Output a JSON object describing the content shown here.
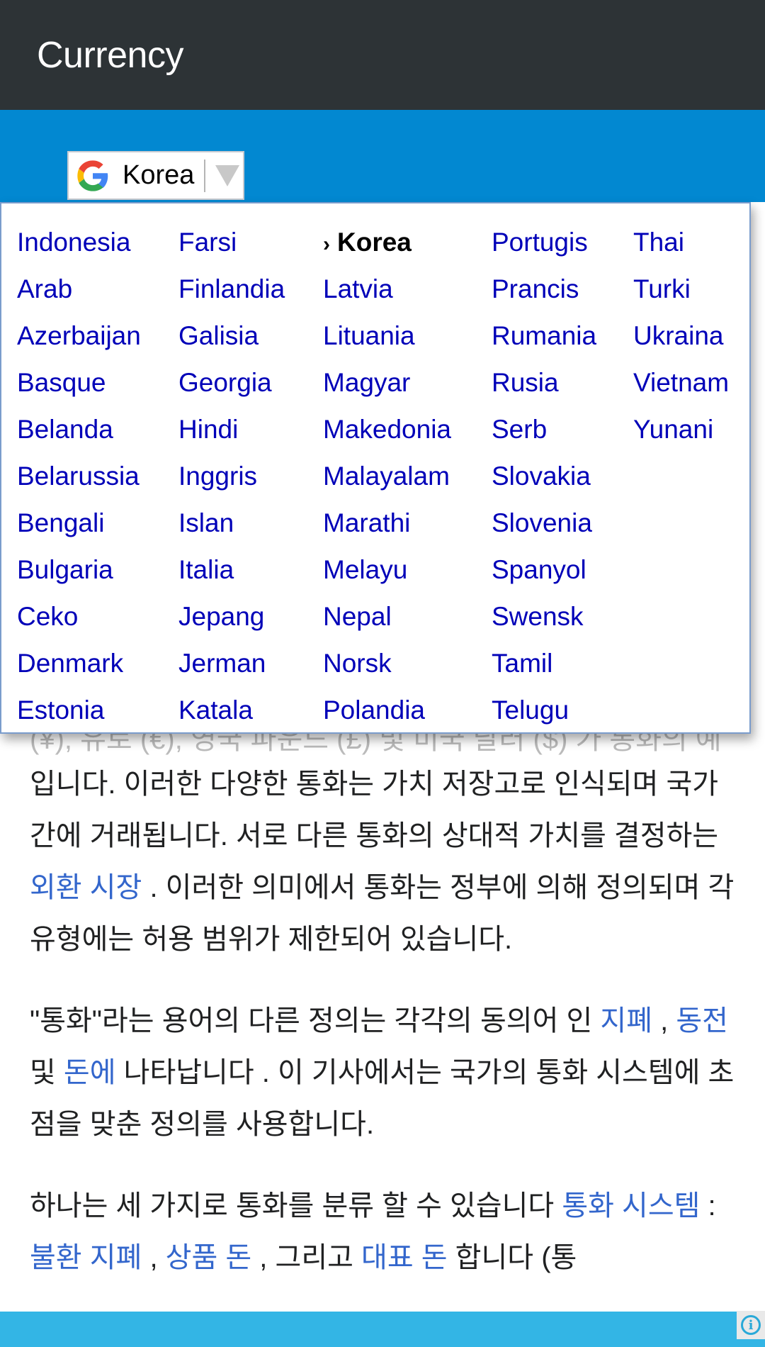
{
  "header": {
    "title": "Currency"
  },
  "translate_widget": {
    "icon": "google-g-icon",
    "selected_language": "Korea",
    "dropdown_icon": "triangle-down-icon"
  },
  "language_menu": {
    "selected": "Korea",
    "selected_marker": "›",
    "columns": [
      [
        "Indonesia",
        "Arab",
        "Azerbaijan",
        "Basque",
        "Belanda",
        "Belarussia",
        "Bengali",
        "Bulgaria",
        "Ceko",
        "Denmark",
        "Estonia"
      ],
      [
        "Farsi",
        "Finlandia",
        "Galisia",
        "Georgia",
        "Hindi",
        "Inggris",
        "Islan",
        "Italia",
        "Jepang",
        "Jerman",
        "Katala"
      ],
      [
        "Korea",
        "Latvia",
        "Lituania",
        "Magyar",
        "Makedonia",
        "Malayalam",
        "Marathi",
        "Melayu",
        "Nepal",
        "Norsk",
        "Polandia"
      ],
      [
        "Portugis",
        "Prancis",
        "Rumania",
        "Rusia",
        "Serb",
        "Slovakia",
        "Slovenia",
        "Spanyol",
        "Swensk",
        "Tamil",
        "Telugu"
      ],
      [
        "Thai",
        "Turki",
        "Ukraina",
        "Vietnam",
        "Yunani"
      ]
    ]
  },
  "article": {
    "ghost_line": "(¥), 유로 (€), 영국 파운드 (£) 및 미국 달러 ($) 가 통화의 예",
    "paragraphs": [
      {
        "segments": [
          {
            "text": "입니다. 이러한 다양한 통화는 가치 저장고로 인식되며 국가간에 거래됩니다. 서로 다른 통화의 상대적 가치를 결정하는 ",
            "link": false
          },
          {
            "text": "외환 시장",
            "link": true
          },
          {
            "text": " .  이러한 의미에서 통화는 정부에 의해 정의되며 각 유형에는 허용 범위가 제한되어 있습니다.",
            "link": false
          }
        ]
      },
      {
        "segments": [
          {
            "text": "\"통화\"라는 용어의 다른 정의는 각각의 동의어 인 ",
            "link": false
          },
          {
            "text": "지폐",
            "link": true
          },
          {
            "text": " ,  ",
            "link": false
          },
          {
            "text": "동전",
            "link": true
          },
          {
            "text": " 및  ",
            "link": false
          },
          {
            "text": "돈에",
            "link": true
          },
          {
            "text": " 나타납니다  . 이 기사에서는 국가의 통화 시스템에 초점을 맞춘 정의를 사용합니다.",
            "link": false
          }
        ]
      },
      {
        "segments": [
          {
            "text": "하나는 세 가지로 통화를 분류 할 수 있습니다  ",
            "link": false
          },
          {
            "text": "통화 시스템",
            "link": true
          },
          {
            "text": " :  ",
            "link": false
          },
          {
            "text": "불환 지폐",
            "link": true
          },
          {
            "text": " ,  ",
            "link": false
          },
          {
            "text": "상품 돈",
            "link": true
          },
          {
            "text": " , 그리고  ",
            "link": false
          },
          {
            "text": "대표 돈",
            "link": true
          },
          {
            "text": " 합니다 (통",
            "link": false
          }
        ]
      }
    ]
  },
  "bottom_bar": {
    "info_icon": "info-icon"
  },
  "colors": {
    "header_bg": "#2d3336",
    "band_bg": "#0288d1",
    "menu_link": "#0000b8",
    "article_link": "#3366cc",
    "bottom_bar": "#33b5e5"
  }
}
